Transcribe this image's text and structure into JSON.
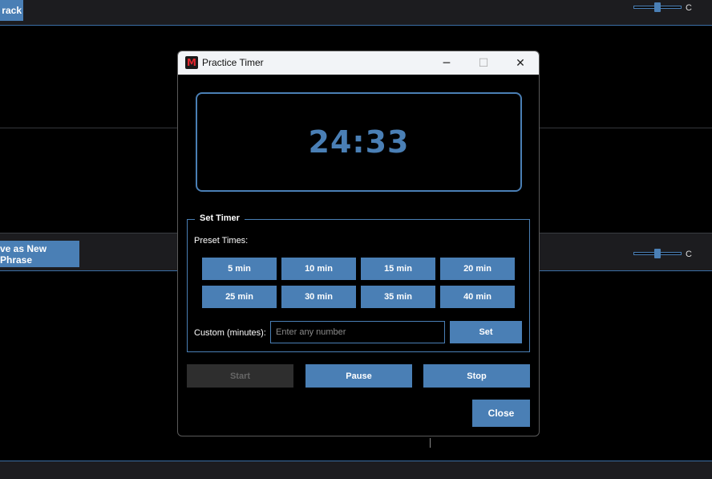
{
  "background": {
    "track_button_label": "rack",
    "phrase_button_label": "ve as New Phrase",
    "slider_top_label": "C",
    "slider_mid_label": "C"
  },
  "window": {
    "title": "Practice Timer",
    "icon": "app-logo-icon",
    "controls": {
      "minimize": "─",
      "maximize": "☐",
      "close": "✕"
    }
  },
  "display": {
    "time": "24:33"
  },
  "set_timer": {
    "title": "Set Timer",
    "preset_label": "Preset Times:",
    "presets": [
      "5 min",
      "10 min",
      "15 min",
      "20 min",
      "25 min",
      "30 min",
      "35 min",
      "40 min"
    ],
    "custom_label": "Custom (minutes):",
    "custom_placeholder": "Enter any number",
    "custom_value": "",
    "set_label": "Set"
  },
  "controls": {
    "start_label": "Start",
    "pause_label": "Pause",
    "stop_label": "Stop",
    "close_label": "Close",
    "start_enabled": false
  },
  "colors": {
    "accent": "#4a7fb5",
    "disabled": "#2e2e2e",
    "background": "#000000"
  }
}
